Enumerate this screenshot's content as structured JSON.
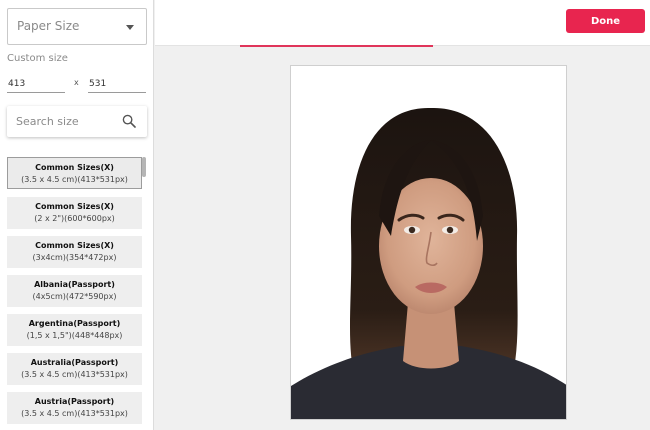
{
  "sidebar": {
    "paper_size_select": {
      "label": "Paper Size"
    },
    "custom_size_label": "Custom size",
    "width_value": "413",
    "separator": "x",
    "height_value": "531",
    "search_placeholder": "Search size",
    "sizes": [
      {
        "name": "Common Sizes(X)",
        "dims": "(3.5 x 4.5 cm)(413*531px)",
        "selected": true
      },
      {
        "name": "Common Sizes(X)",
        "dims": "(2 x 2\")(600*600px)"
      },
      {
        "name": "Common Sizes(X)",
        "dims": "(3x4cm)(354*472px)"
      },
      {
        "name": "Albania(Passport)",
        "dims": "(4x5cm)(472*590px)"
      },
      {
        "name": "Argentina(Passport)",
        "dims": "(1,5 x 1,5\")(448*448px)"
      },
      {
        "name": "Australia(Passport)",
        "dims": "(3.5 x 4.5 cm)(413*531px)"
      },
      {
        "name": "Austria(Passport)",
        "dims": "(3.5 x 4.5 cm)(413*531px)"
      }
    ]
  },
  "toolbar": {
    "done_label": "Done"
  },
  "colors": {
    "accent": "#e8254f",
    "background": "#f0f0f0"
  },
  "icons": {
    "dropdown": "chevron-down-icon",
    "search": "search-icon"
  }
}
